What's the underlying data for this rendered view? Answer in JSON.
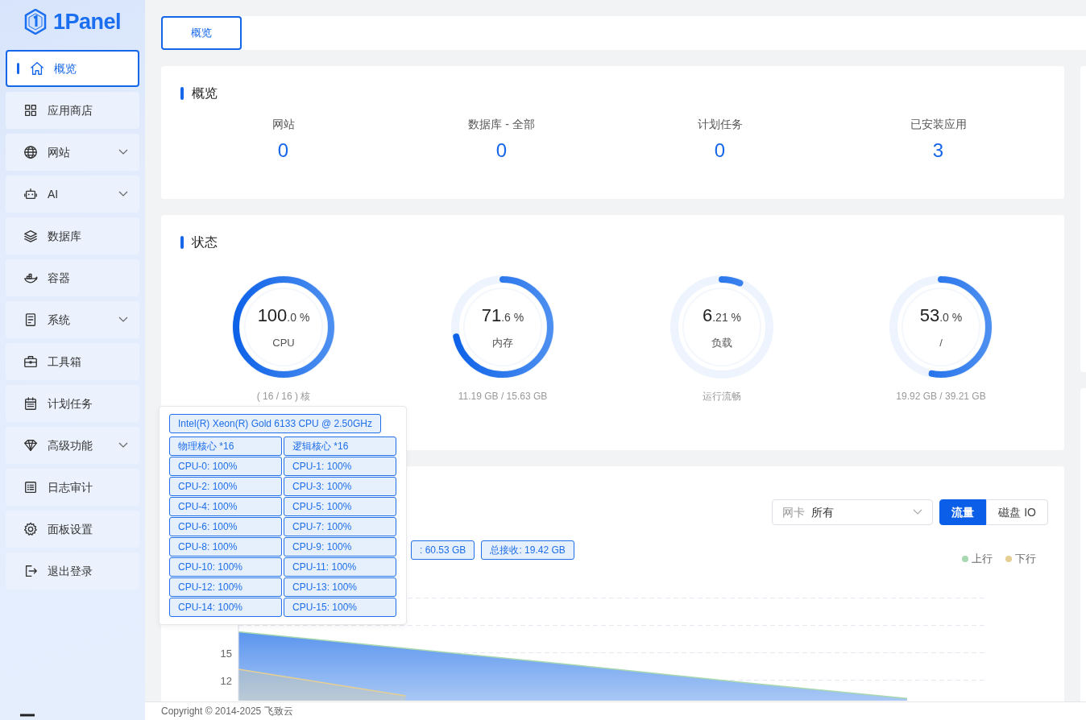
{
  "logo": {
    "text": "1Panel"
  },
  "sidebar": {
    "items": [
      {
        "label": "概览",
        "selected": true,
        "expandable": false
      },
      {
        "label": "应用商店",
        "selected": false,
        "expandable": false
      },
      {
        "label": "网站",
        "selected": false,
        "expandable": true
      },
      {
        "label": "AI",
        "selected": false,
        "expandable": true
      },
      {
        "label": "数据库",
        "selected": false,
        "expandable": false
      },
      {
        "label": "容器",
        "selected": false,
        "expandable": false
      },
      {
        "label": "系统",
        "selected": false,
        "expandable": true
      },
      {
        "label": "工具箱",
        "selected": false,
        "expandable": false
      },
      {
        "label": "计划任务",
        "selected": false,
        "expandable": false
      },
      {
        "label": "高级功能",
        "selected": false,
        "expandable": true
      },
      {
        "label": "日志审计",
        "selected": false,
        "expandable": false
      },
      {
        "label": "面板设置",
        "selected": false,
        "expandable": false
      },
      {
        "label": "退出登录",
        "selected": false,
        "expandable": false
      }
    ]
  },
  "tabs": [
    {
      "label": "概览",
      "selected": true
    }
  ],
  "overview": {
    "title": "概览",
    "stats": [
      {
        "label": "网站",
        "value": "0"
      },
      {
        "label": "数据库 - 全部",
        "value": "0"
      },
      {
        "label": "计划任务",
        "value": "0"
      },
      {
        "label": "已安装应用",
        "value": "3"
      }
    ]
  },
  "status": {
    "title": "状态",
    "gauges": [
      {
        "value": "100",
        "decimals": ".0 %",
        "label": "CPU",
        "level": 1.0,
        "detail": "( 16 / 16 ) 核"
      },
      {
        "value": "71",
        "decimals": ".6 %",
        "label": "内存",
        "level": 0.716,
        "detail": "11.19 GB / 15.63 GB"
      },
      {
        "value": "6",
        "decimals": ".21 %",
        "label": "负载",
        "level": 0.0621,
        "detail": "运行流畅"
      },
      {
        "value": "53",
        "decimals": ".0 %",
        "label": "/",
        "level": 0.53,
        "detail": "19.92 GB / 39.21 GB"
      }
    ]
  },
  "cpu_popover": {
    "model": "Intel(R) Xeon(R) Gold 6133 CPU @ 2.50GHz",
    "cores": [
      "物理核心 *16",
      "逻辑核心 *16",
      "CPU-0: 100%",
      "CPU-1: 100%",
      "CPU-2: 100%",
      "CPU-3: 100%",
      "CPU-4: 100%",
      "CPU-5: 100%",
      "CPU-6: 100%",
      "CPU-7: 100%",
      "CPU-8: 100%",
      "CPU-9: 100%",
      "CPU-10: 100%",
      "CPU-11: 100%",
      "CPU-12: 100%",
      "CPU-13: 100%",
      "CPU-14: 100%",
      "CPU-15: 100%"
    ]
  },
  "monitor": {
    "nic_select": {
      "label": "网卡",
      "value": "所有"
    },
    "toggle": [
      {
        "label": "流量",
        "selected": true
      },
      {
        "label": "磁盘 IO",
        "selected": false
      }
    ],
    "tags": [
      ": 60.53 GB",
      "总接收: 19.42 GB"
    ],
    "chart_data": {
      "type": "area",
      "ylim": [
        9.7,
        23
      ],
      "yticks": [
        12,
        15
      ],
      "series": [
        {
          "name": "上行",
          "color": "#a8d8b0",
          "values": [
            17.3,
            15.5,
            13.7,
            11.8,
            10.0
          ]
        },
        {
          "name": "下行",
          "color": "#e6cf92",
          "values": [
            13.2,
            10.3,
            null,
            null,
            null
          ]
        }
      ]
    }
  },
  "footer": {
    "text": "Copyright © 2014-2025 飞致云"
  }
}
